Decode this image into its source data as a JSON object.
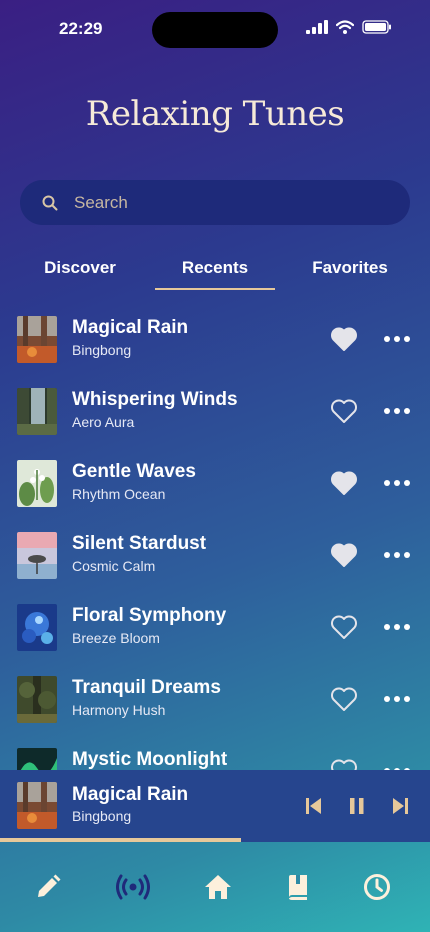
{
  "status": {
    "time": "22:29"
  },
  "title": "Relaxing Tunes",
  "search": {
    "placeholder": "Search"
  },
  "tabs": [
    {
      "label": "Discover",
      "active": false
    },
    {
      "label": "Recents",
      "active": true
    },
    {
      "label": "Favorites",
      "active": false
    }
  ],
  "songs": [
    {
      "title": "Magical Rain",
      "artist": "Bingbong",
      "favorite": true
    },
    {
      "title": "Whispering Winds",
      "artist": "Aero Aura",
      "favorite": false
    },
    {
      "title": "Gentle Waves",
      "artist": "Rhythm Ocean",
      "favorite": true
    },
    {
      "title": "Silent Stardust",
      "artist": "Cosmic Calm",
      "favorite": true
    },
    {
      "title": "Floral Symphony",
      "artist": "Breeze Bloom",
      "favorite": false
    },
    {
      "title": "Tranquil Dreams",
      "artist": "Harmony Hush",
      "favorite": false
    },
    {
      "title": "Mystic Moonlight",
      "artist": "",
      "favorite": false
    }
  ],
  "now_playing": {
    "title": "Magical Rain",
    "artist": "Bingbong",
    "progress": 0.56,
    "state": "playing"
  },
  "nav": [
    {
      "icon": "pencil-icon"
    },
    {
      "icon": "broadcast-icon",
      "active": true
    },
    {
      "icon": "home-icon"
    },
    {
      "icon": "book-icon"
    },
    {
      "icon": "clock-icon"
    }
  ],
  "colors": {
    "accent": "#e6c89a",
    "active_nav": "#1f2a7a",
    "search_bg": "#1e2a7a",
    "player_bg": "#26458e"
  }
}
